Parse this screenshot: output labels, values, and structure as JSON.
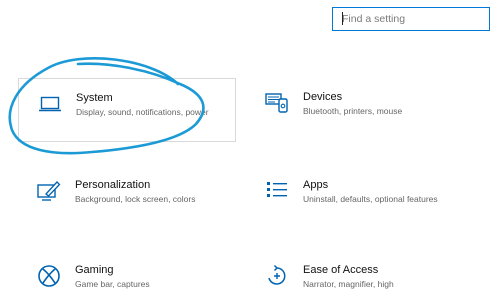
{
  "search": {
    "placeholder": "Find a setting"
  },
  "tiles": [
    {
      "icon": "laptop-icon",
      "title": "System",
      "desc": "Display, sound, notifications, power"
    },
    {
      "icon": "devices-icon",
      "title": "Devices",
      "desc": "Bluetooth, printers, mouse"
    },
    {
      "icon": "personalization-icon",
      "title": "Personalization",
      "desc": "Background, lock screen, colors"
    },
    {
      "icon": "apps-icon",
      "title": "Apps",
      "desc": "Uninstall, defaults, optional features"
    },
    {
      "icon": "xbox-icon",
      "title": "Gaming",
      "desc": "Game bar, captures"
    },
    {
      "icon": "ease-of-access-icon",
      "title": "Ease of Access",
      "desc": "Narrator, magnifier, high"
    }
  ],
  "colors": {
    "accent": "#0078d7",
    "annotation": "#1c9ad6"
  }
}
